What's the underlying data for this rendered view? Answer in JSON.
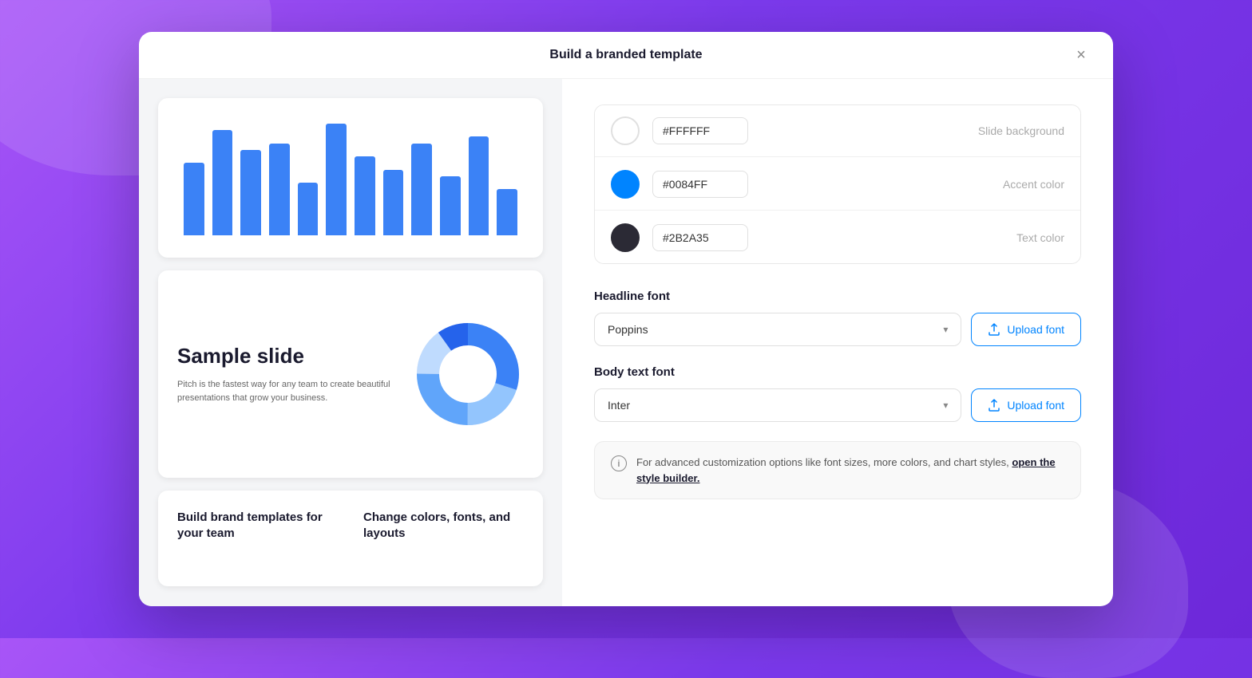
{
  "background": {
    "color_start": "#a855f7",
    "color_end": "#6d28d9"
  },
  "modal": {
    "title": "Build a branded template",
    "close_icon": "×"
  },
  "slides": [
    {
      "type": "bar_chart",
      "bars": [
        55,
        80,
        65,
        70,
        40,
        85,
        60,
        50,
        70,
        45,
        75,
        35
      ]
    },
    {
      "type": "sample",
      "title": "Sample slide",
      "description": "Pitch is the fastest way for any team to create beautiful presentations that grow your business.",
      "donut": {
        "segments": [
          {
            "color": "#3b82f6",
            "value": 30
          },
          {
            "color": "#93c5fd",
            "value": 20
          },
          {
            "color": "#60a5fa",
            "value": 25
          },
          {
            "color": "#bfdbfe",
            "value": 15
          },
          {
            "color": "#2563eb",
            "value": 10
          }
        ]
      }
    },
    {
      "type": "text_columns",
      "col1": "Build brand templates for your team",
      "col2": "Change colors, fonts, and layouts"
    }
  ],
  "colors": [
    {
      "id": "slide_background",
      "swatch": "#FFFFFF",
      "swatch_border": "#e0e0e0",
      "hex_value": "#FFFFFF",
      "label": "Slide background"
    },
    {
      "id": "accent_color",
      "swatch": "#0084FF",
      "swatch_border": "#0084FF",
      "hex_value": "#0084FF",
      "label": "Accent color"
    },
    {
      "id": "text_color",
      "swatch": "#2B2A35",
      "swatch_border": "#2B2A35",
      "hex_value": "#2B2A35",
      "label": "Text color"
    }
  ],
  "fonts": {
    "headline": {
      "section_title": "Headline font",
      "selected_font": "Poppins",
      "upload_label": "Upload font"
    },
    "body": {
      "section_title": "Body text font",
      "selected_font": "Inter",
      "upload_label": "Upload font"
    }
  },
  "info": {
    "text": "For advanced customization options like font sizes, more colors, and chart styles,",
    "link_text": "open the style builder.",
    "icon": "i"
  }
}
